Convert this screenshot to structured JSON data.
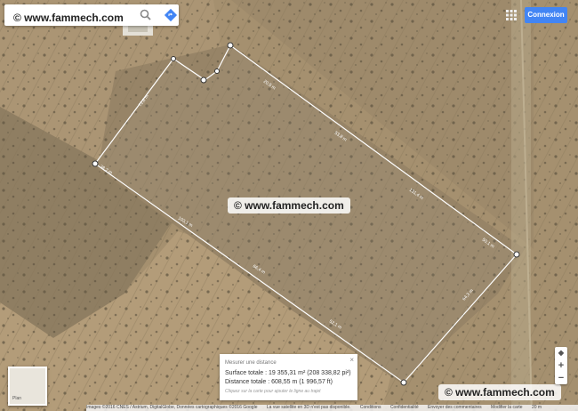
{
  "search": {
    "placeholder": ""
  },
  "header": {
    "signin_label": "Connexion"
  },
  "watermarks": [
    "© www.fammech.com",
    "© www.fammech.com",
    "© www.fammech.com"
  ],
  "map_toggle": {
    "label": "Plan"
  },
  "measure": {
    "title": "Mesurer une distance",
    "area": "Surface totale : 19 355,31 m² (208 338,82 pi²)",
    "distance": "Distance totale : 608,55 m (1 996,57 ft)",
    "hint": "Cliquez sur la carte pour ajouter le ligne au trajet",
    "close": "×"
  },
  "zoom": {
    "compass": "◆",
    "in": "+",
    "out": "−"
  },
  "footer": {
    "attribution": "Images ©2016 CNES / Astrium, DigitalGlobe, Données cartographiques ©2016 Google",
    "view3d": "La vue satellite en 3D n'est pas disponible.",
    "terms": "Conditions",
    "privacy": "Confidentialité",
    "feedback": "Envoyer des commentaires",
    "scale": "Modifier la carte",
    "scale_value": "20 m"
  },
  "segment_labels": [
    "72,6 m",
    "20,5 m",
    "53,8 m",
    "131,4 m",
    "50,1 m",
    "64,3 m",
    "103,1 m",
    "66,4 m",
    "52,1 m",
    "38,2 m"
  ],
  "colors": {
    "accent": "#4285f4",
    "terrain": "#a08b6c",
    "outline": "#ffffff"
  },
  "icons": {
    "search": "search-icon",
    "directions": "directions-icon",
    "apps": "apps-grid-icon"
  }
}
